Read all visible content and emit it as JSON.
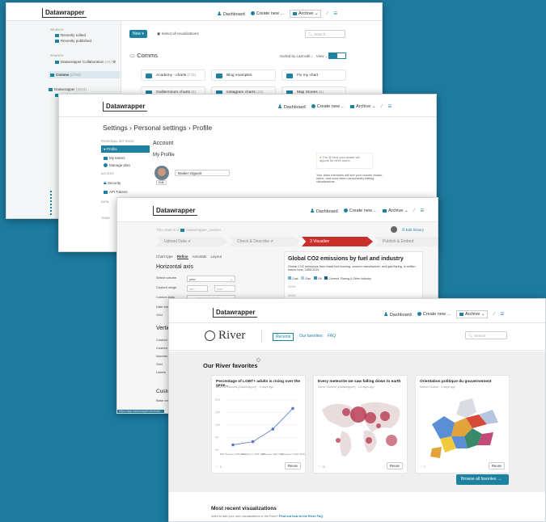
{
  "brand": "Datawrapper",
  "topnav": {
    "dashboard": "Dashboard",
    "create": "Create new ...",
    "archive": "Archive"
  },
  "win1": {
    "new_btn": "New",
    "select_all": "Select all visualizations",
    "search_placeholder": "Search",
    "folder_title": "Comms",
    "sorted": "Sorted by Last edit",
    "view": "View",
    "sidebar": {
      "search": "SEARCH",
      "recently_edited": "Recently edited",
      "recently_published": "Recently published",
      "shared": "SHARED",
      "collab": "Datawrapper Collaboration",
      "collab_count": "(34)",
      "comms": "Comms",
      "comms_count": "(2793)",
      "dw": "Datawrapper",
      "dw_count": "(2204)",
      "bookmarks": "Bookmarks",
      "bookmarks_count": "(31)"
    },
    "folders": [
      "Academy - charts",
      "Blog examples",
      "Fix my chart",
      "Guillermina's charts",
      "Instagram charts",
      "Map Stories"
    ],
    "folder_counts": [
      "(711)",
      "",
      "",
      "(5)",
      "(10)",
      "(5)"
    ]
  },
  "win2": {
    "breadcrumb": "Settings › Personal settings › Profile",
    "personal": "PERSONAL SETTINGS",
    "profile": "Profile",
    "my_teams": "My teams",
    "manage_plan": "Manage plan",
    "access": "ACCESS",
    "security": "Security",
    "api": "API Tokens",
    "data": "DATA",
    "team": "TEAM",
    "account": "Account",
    "my_profile": "My Profile",
    "name_value": "Maiden Gigwort",
    "edit": "Edit",
    "note1": "The @ here your avatar will appear for other users.",
    "note2": "Your team members will see your chosen avatar, name, and color when concurrently editing visualizations."
  },
  "win3": {
    "chart_in": "This chart is in",
    "folder": "Datawrapper_custom",
    "edit_history": "Edit history",
    "steps": [
      "Upload Data ✔",
      "Check & Describe ✔",
      "3  Visualize",
      "Publish & Embed"
    ],
    "tabs": [
      "Chart type",
      "Refine",
      "Annotate",
      "Layout"
    ],
    "axis_title": "Horizontal axis",
    "rows": [
      "Select column",
      "Custom range",
      "Custom ticks",
      "Date format",
      "Grid"
    ],
    "select_value": "year",
    "min_ph": "min",
    "max_ph": "max",
    "ticks_ph": "e.g. 1990,2000,2010",
    "vertical": "Vertica",
    "vrows": [
      "Custom ra",
      "Custom ti",
      "Number fo",
      "Grid",
      "Labels"
    ],
    "custom": "Custom",
    "base": "Base color",
    "chart_title": "Global CO2 emissions by fuel and industry",
    "chart_sub": "Global CO2 emissions from fossil fuel burning, cement manufacture, and gas flaring, in million metric tons, 1850-2021",
    "legend": [
      "Coal",
      "Gas",
      "Oil",
      "Cement, Flaring & Other industry"
    ],
    "y_ticks": [
      "35000",
      "30000",
      "25000",
      "20000",
      "15000",
      "10000"
    ],
    "url": "https://app.datawrapper.de/chart/..."
  },
  "win4": {
    "river": "River",
    "tabs": [
      "Recents",
      "Our favorites",
      "FAQ"
    ],
    "search_placeholder": "Search",
    "favorites": "Our River favorites",
    "cards": [
      {
        "title": "Percentage of LGBT+ adults is rising over the gene...",
        "author": "Andrew Barrows (Datawrapper) · 3 days ago",
        "likes": "5",
        "reuse": "Reuse"
      },
      {
        "title": "Every meteorite we saw falling down to earth",
        "author": "Some Student (Datawrapper) · 14 days ago",
        "likes": "19",
        "reuse": "Reuse"
      },
      {
        "title": "Orientation politique du gouvernement",
        "author": "Marcel Lauber · 4 days ago",
        "likes": "2",
        "reuse": "Reuse"
      }
    ],
    "browse": "Browse all favorites  →",
    "recent": "Most recent visualizations",
    "recent_sub": "Want to add your own visualizations to the River?",
    "recent_link": "Find out how in the River FAQ",
    "lgbt_labels": [
      "Baby Boomers (1946-1964)",
      "Generation X (1965-1980)",
      "Millennials (1981-1996)",
      "Generation Z (1997-2004)"
    ],
    "lgbt_values": [
      2.6,
      4.2,
      10.5,
      20.8
    ],
    "lgbt_yticks": [
      "20%",
      "15%",
      "10%",
      "5%",
      "0%"
    ]
  }
}
